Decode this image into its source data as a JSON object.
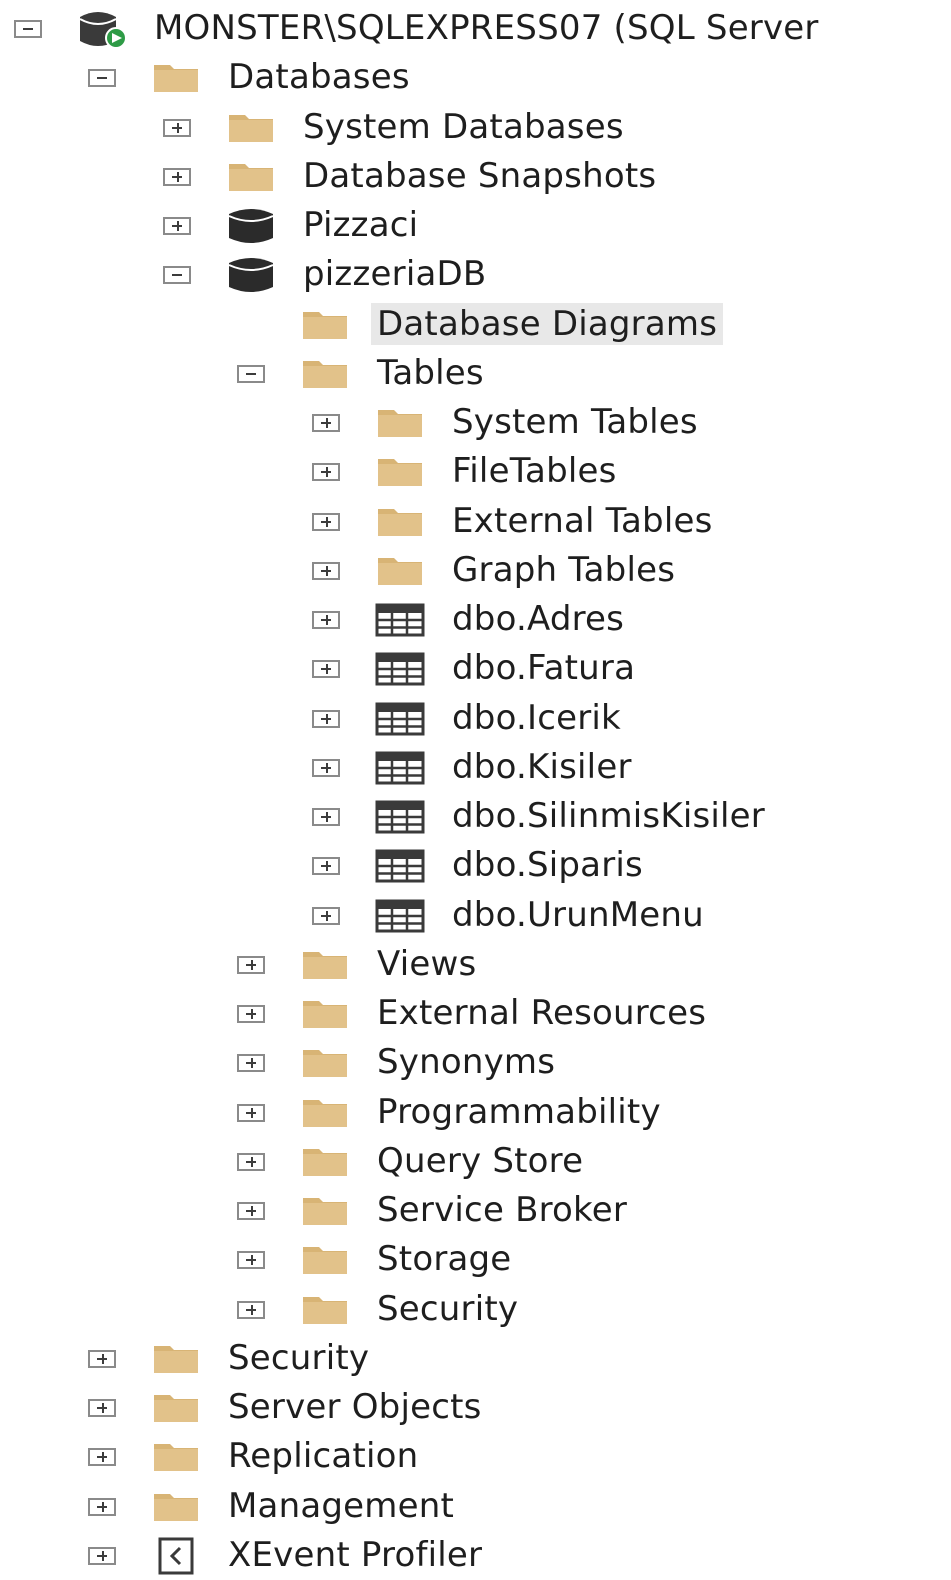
{
  "colors": {
    "folder": "#e2c28a",
    "folder_tab": "#d8b475",
    "database": "#2b2b2b",
    "table_grid": "#3a3a3a",
    "server_badge": "#2e9b46",
    "selection": "#e8e8e8",
    "text": "#1e1e1e"
  },
  "tree": {
    "server": {
      "label": "MONSTER\\SQLEXPRESS07 (SQL Server",
      "icon": "server-icon",
      "expanded": true
    },
    "nodes": {
      "databases": "Databases",
      "system_databases": "System Databases",
      "database_snapshots": "Database Snapshots",
      "pizzaci": "Pizzaci",
      "pizzeriadb": "pizzeriaDB",
      "database_diagrams": "Database Diagrams",
      "tables": "Tables",
      "system_tables": "System Tables",
      "filetables": "FileTables",
      "external_tables": "External Tables",
      "graph_tables": "Graph Tables",
      "dbo_adres": "dbo.Adres",
      "dbo_fatura": "dbo.Fatura",
      "dbo_icerik": "dbo.Icerik",
      "dbo_kisiler": "dbo.Kisiler",
      "dbo_silinmiskisiler": "dbo.SilinmisKisiler",
      "dbo_siparis": "dbo.Siparis",
      "dbo_urunmenu": "dbo.UrunMenu",
      "views": "Views",
      "external_resources": "External Resources",
      "synonyms": "Synonyms",
      "programmability": "Programmability",
      "query_store": "Query Store",
      "service_broker": "Service Broker",
      "storage": "Storage",
      "db_security": "Security",
      "security": "Security",
      "server_objects": "Server Objects",
      "replication": "Replication",
      "management": "Management",
      "xevent_profiler": "XEvent Profiler"
    },
    "selected": "Database Diagrams"
  }
}
